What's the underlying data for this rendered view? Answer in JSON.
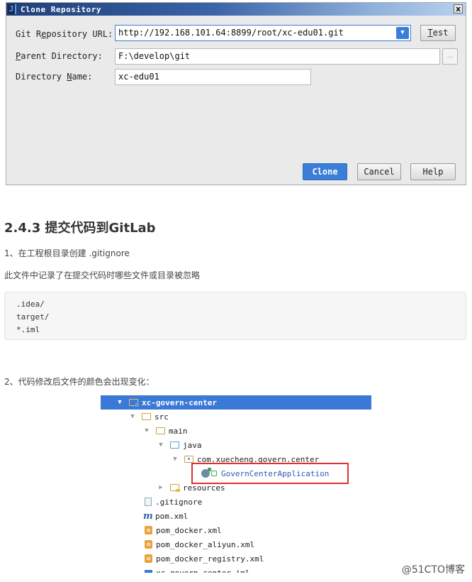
{
  "dialog": {
    "title": "Clone Repository",
    "close_label": "x",
    "app_icon_glyph": "J",
    "url_label_pre": "Git R",
    "url_label_u": "e",
    "url_label_post": "pository URL:",
    "url_value": "http://192.168.101.64:8899/root/xc-edu01.git",
    "combo_arrow": "▼",
    "test_label_u": "T",
    "test_label_post": "est",
    "parent_label_u": "P",
    "parent_label_post": "arent Directory:",
    "parent_value": "F:\\develop\\git",
    "browse_label": "...",
    "name_label_pre": "Directory ",
    "name_label_u": "N",
    "name_label_post": "ame:",
    "name_value": "xc-edu01",
    "clone_label": "Clone",
    "cancel_label": "Cancel",
    "help_label": "Help"
  },
  "article": {
    "heading": "2.4.3 提交代码到GitLab",
    "step1": "1、在工程根目录创建 .gitignore",
    "desc": "此文件中记录了在提交代码时哪些文件或目录被忽略",
    "code_lines": [
      ".idea/",
      "target/",
      "*.iml"
    ],
    "step2": "2、代码修改后文件的颜色会出现变化："
  },
  "tree": {
    "root": "xc-govern-center",
    "src": "src",
    "main": "main",
    "java": "java",
    "package": "com.xuecheng.govern.center",
    "app_class": "GovernCenterApplication",
    "resources": "resources",
    "gitignore": ".gitignore",
    "pom": "pom.xml",
    "pom_docker": "pom_docker.xml",
    "pom_docker_aliyun": "pom_docker_aliyun.xml",
    "pom_docker_registry": "pom_docker_registry.xml",
    "iml": "xc-govern-center.iml",
    "expanded_arrow": "▼",
    "collapsed_arrow": "▶",
    "m_glyph": "m"
  },
  "watermark": "@51CTO博客"
}
